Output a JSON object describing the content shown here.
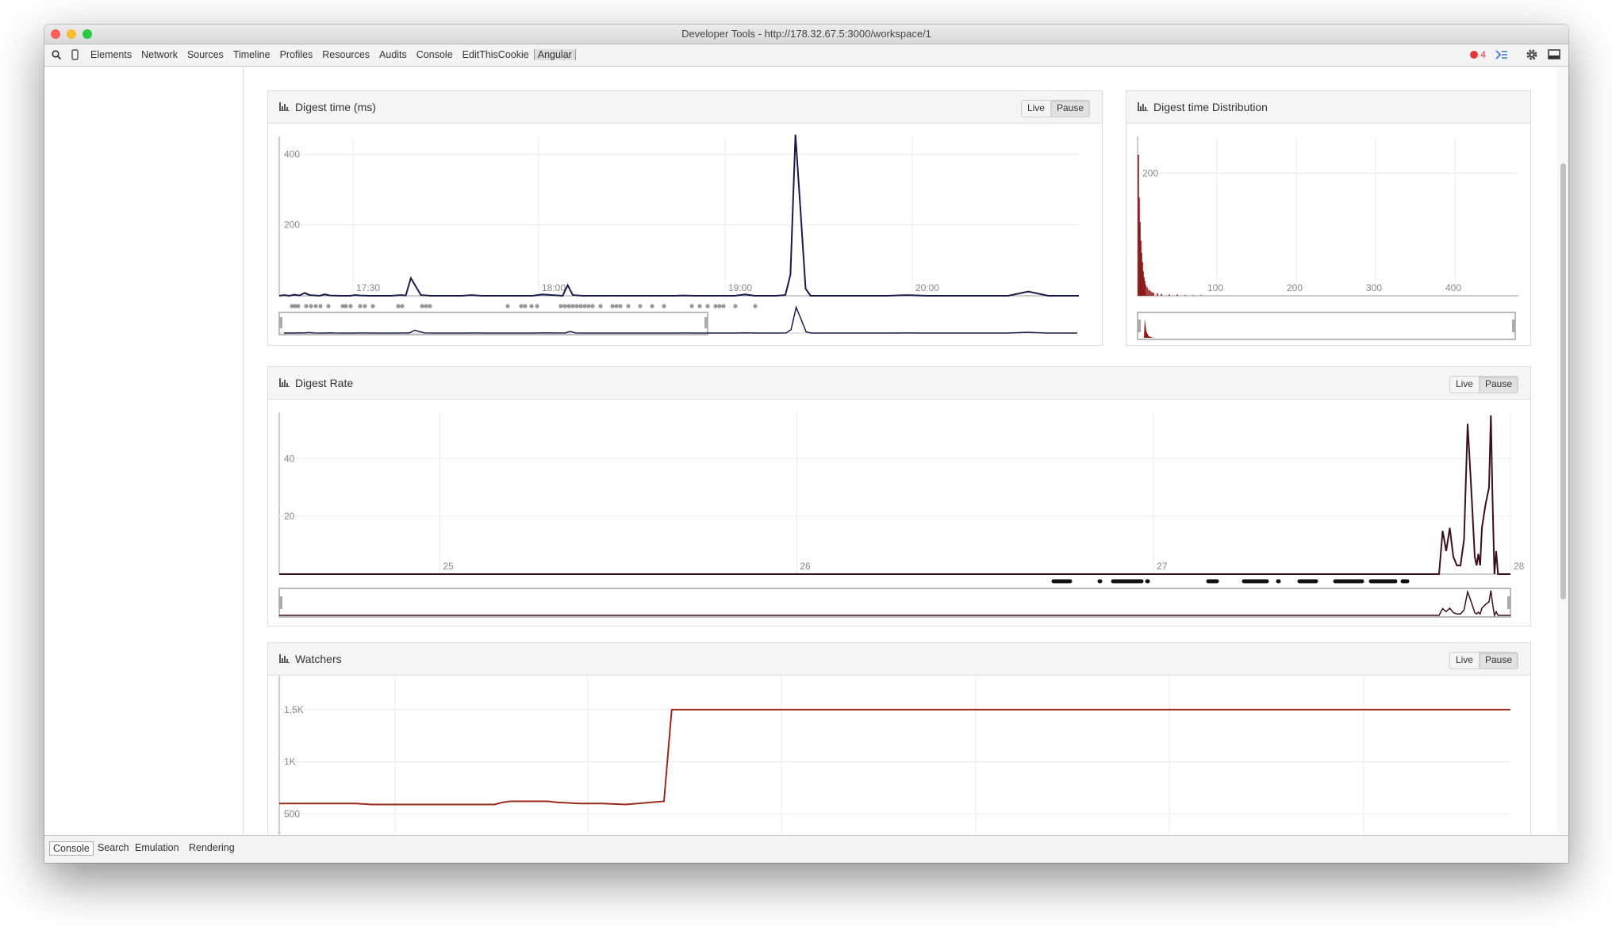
{
  "window": {
    "title": "Developer Tools - http://178.32.67.5:3000/workspace/1"
  },
  "toolbar": {
    "tabs": [
      "Elements",
      "Network",
      "Sources",
      "Timeline",
      "Profiles",
      "Resources",
      "Audits",
      "Console",
      "EditThisCookie",
      "Angular"
    ],
    "selected_tab": "Angular",
    "error_count": "4"
  },
  "bottom_tabs": [
    "Console",
    "Search",
    "Emulation",
    "Rendering"
  ],
  "buttons": {
    "live": "Live",
    "pause": "Pause"
  },
  "chart_data": [
    {
      "type": "line",
      "title": "Digest time (ms)",
      "x_ticks": [
        "17:30",
        "18:00",
        "19:00",
        "20:00"
      ],
      "y_ticks": [
        "200",
        "400"
      ],
      "ylim": [
        0,
        450
      ],
      "x": [
        0,
        5,
        10,
        15,
        20,
        25,
        30,
        40,
        45,
        50,
        60,
        70,
        75,
        80,
        90,
        100,
        110,
        120,
        125,
        130,
        140,
        150,
        160,
        170,
        180,
        190,
        200,
        210,
        220,
        230,
        240,
        250,
        260,
        270,
        280,
        285,
        290,
        300,
        310,
        320,
        330,
        340,
        350,
        360,
        370,
        380,
        390,
        400,
        410,
        420,
        430,
        440,
        450,
        460,
        470,
        480,
        490,
        500,
        505,
        510,
        515,
        520,
        525,
        530,
        540,
        560,
        580,
        600,
        620,
        640,
        660,
        680,
        700,
        720,
        740,
        760,
        780,
        790
      ],
      "y": [
        0,
        2,
        0,
        3,
        1,
        8,
        2,
        0,
        4,
        1,
        0,
        0,
        2,
        1,
        0,
        0,
        0,
        2,
        1,
        50,
        2,
        0,
        0,
        0,
        0,
        2,
        0,
        0,
        0,
        0,
        0,
        0,
        4,
        2,
        0,
        30,
        2,
        0,
        0,
        0,
        0,
        0,
        0,
        0,
        0,
        0,
        0,
        1,
        0,
        0,
        0,
        0,
        0,
        4,
        0,
        0,
        0,
        2,
        60,
        455,
        240,
        20,
        0,
        0,
        0,
        0,
        0,
        0,
        2,
        0,
        0,
        0,
        0,
        0,
        12,
        0,
        0,
        0
      ],
      "ylabel": "",
      "xlabel": "",
      "grid": true
    },
    {
      "type": "bar",
      "title": "Digest time Distribution",
      "x_ticks": [
        "100",
        "200",
        "300",
        "400"
      ],
      "y_ticks": [
        "200"
      ],
      "ylim": [
        0,
        260
      ],
      "xlim": [
        0,
        480
      ],
      "bins": [
        1,
        2,
        3,
        4,
        5,
        6,
        7,
        8,
        9,
        10,
        12,
        14,
        16,
        18,
        20,
        25,
        30,
        40,
        50,
        60,
        70,
        80
      ],
      "counts": [
        230,
        160,
        120,
        90,
        70,
        55,
        40,
        30,
        24,
        18,
        14,
        10,
        8,
        6,
        5,
        4,
        3,
        2,
        2,
        1,
        1,
        1
      ]
    },
    {
      "type": "line",
      "title": "Digest Rate",
      "x_ticks": [
        "25",
        "26",
        "27",
        "28"
      ],
      "y_ticks": [
        "20",
        "40"
      ],
      "xlim": [
        24.55,
        28
      ],
      "ylim": [
        0,
        56
      ],
      "x": [
        24.55,
        27.8,
        27.81,
        27.82,
        27.83,
        27.84,
        27.85,
        27.86,
        27.87,
        27.88,
        27.89,
        27.9,
        27.905,
        27.91,
        27.915,
        27.92,
        27.93,
        27.94,
        27.945,
        27.95,
        27.955,
        27.96,
        27.965,
        27.97,
        27.975,
        27.98,
        27.99,
        28
      ],
      "y": [
        0,
        0,
        15,
        8,
        16,
        6,
        3,
        3,
        12,
        52,
        30,
        6,
        3,
        7,
        3,
        16,
        24,
        30,
        55,
        25,
        0,
        8,
        0,
        0,
        0,
        0,
        0,
        0
      ],
      "grid": true
    },
    {
      "type": "line",
      "title": "Watchers",
      "y_ticks": [
        "500",
        "1K",
        "1,5K"
      ],
      "ylim": [
        0,
        1500
      ],
      "x": [
        0,
        85,
        100,
        120,
        280,
        290,
        300,
        350,
        360,
        390,
        420,
        450,
        500,
        510,
        1600
      ],
      "y": [
        600,
        600,
        600,
        590,
        590,
        610,
        620,
        620,
        610,
        600,
        600,
        590,
        620,
        1500,
        1500
      ],
      "grid": true
    }
  ],
  "colors": {
    "digest_line": "#1a1a4a",
    "rate_line": "#3a1020",
    "watchers_line": "#9b2a1a",
    "dist_bars": "#8b1a1a"
  }
}
